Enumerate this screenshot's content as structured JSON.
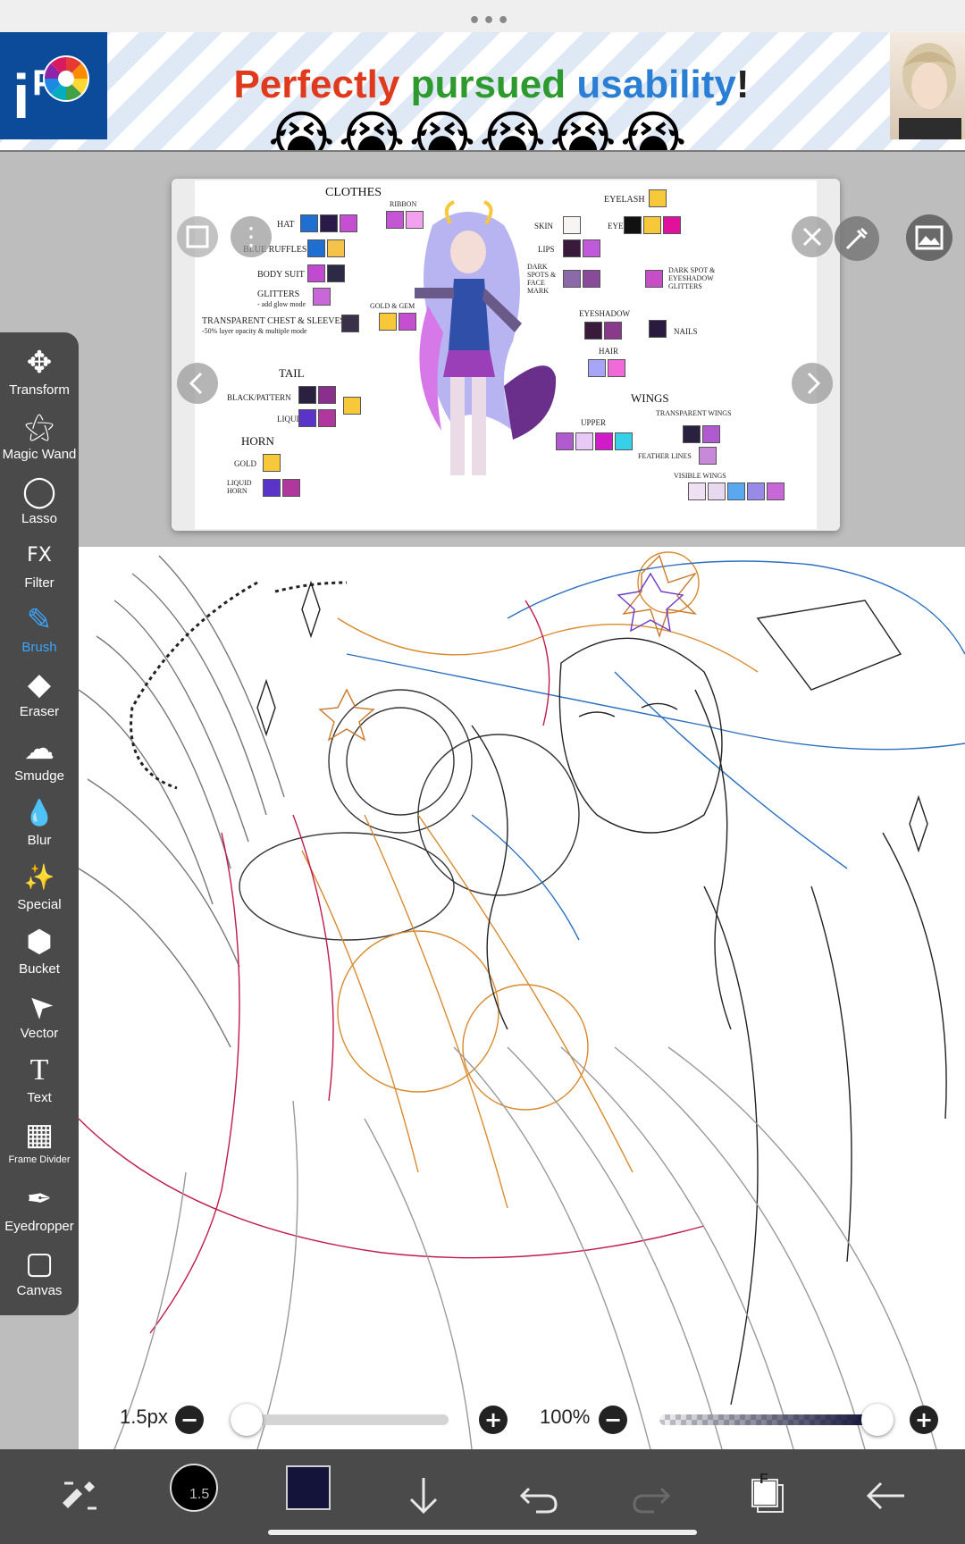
{
  "ad": {
    "headline_word1": "Perfectly",
    "headline_word2": "pursued",
    "headline_word3": "usability",
    "headline_end": "!",
    "emojis": "😭😭😭😭😭😭",
    "color_word1": "#e03a1e",
    "color_word2": "#2e9a2e",
    "color_word3": "#2a7fd4"
  },
  "reference": {
    "sheet": {
      "clothes": "CLOTHES",
      "hat": "HAT",
      "ribbon": "RIBBON",
      "blue_ruffles": "BLUE RUFFLES",
      "body_suit": "BODY SUIT",
      "glitters": "GLITTERS",
      "glitters_note": "- add glow mode",
      "gold_gem": "GOLD & GEM",
      "transparent_chest": "TRANSPARENT CHEST & SLEEVES",
      "transparent_note": "-50% layer opacity & multiple mode",
      "tail": "TAIL",
      "black_pattern": "BLACK/PATTERN",
      "liquid": "LIQUID",
      "horn": "HORN",
      "gold": "GOLD",
      "liquid_horn": "LIQUID HORN",
      "eyelash": "EYELASH",
      "skin": "SKIN",
      "eye": "EYE",
      "lips": "LIPS",
      "dark_spots": "DARK SPOTS & FACE MARK",
      "dark_spot_glitters": "DARK SPOT & EYESHADOW GLITTERS",
      "eyeshadow": "EYESHADOW",
      "nails": "NAILS",
      "hair": "HAIR",
      "wings": "WINGS",
      "transparent_wings": "TRANSPARENT WINGS",
      "upper": "UPPER",
      "feather_lines": "FEATHER LINES",
      "visible_wings": "VISIBLE WINGS"
    }
  },
  "toolbar": {
    "tools": [
      {
        "label": "Transform",
        "icon": "✥"
      },
      {
        "label": "Magic Wand",
        "icon": "⚝"
      },
      {
        "label": "Lasso",
        "icon": "◯"
      },
      {
        "label": "Filter",
        "icon": "FX"
      },
      {
        "label": "Brush",
        "icon": "✎"
      },
      {
        "label": "Eraser",
        "icon": "◆"
      },
      {
        "label": "Smudge",
        "icon": "☁"
      },
      {
        "label": "Blur",
        "icon": "💧"
      },
      {
        "label": "Special",
        "icon": "✨"
      },
      {
        "label": "Bucket",
        "icon": "⬢"
      },
      {
        "label": "Vector",
        "icon": "➤"
      },
      {
        "label": "Text",
        "icon": "T"
      },
      {
        "label": "Frame Divider",
        "icon": "▦"
      },
      {
        "label": "Eyedropper",
        "icon": "✒"
      },
      {
        "label": "Canvas",
        "icon": "▢"
      }
    ],
    "active_tool": "Brush"
  },
  "sliders": {
    "brush_size": "1.5px",
    "opacity": "100%",
    "minus": "−",
    "plus": "+"
  },
  "bottombar": {
    "brush_size_badge": "1.5",
    "current_color": "#14143a",
    "layers_badge": "F"
  },
  "colors": {
    "toolbar_bg": "#4a4a4a",
    "accent": "#39a6ff"
  }
}
